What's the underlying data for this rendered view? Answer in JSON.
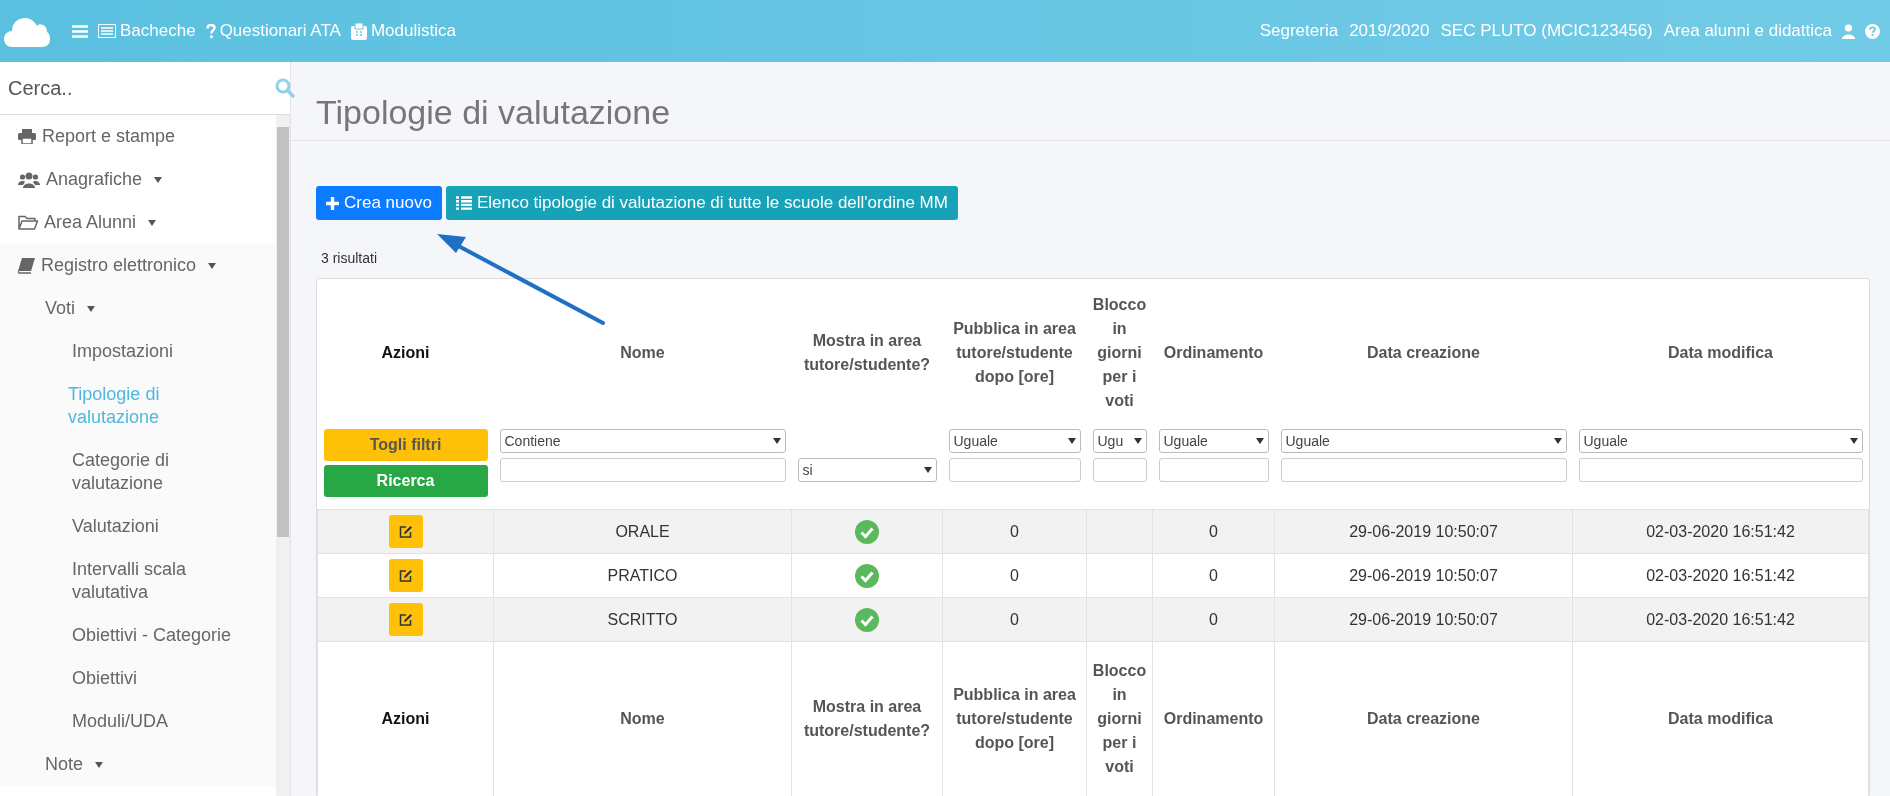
{
  "topbar": {
    "nav": [
      {
        "label": "Bacheche"
      },
      {
        "label": "Questionari ATA"
      },
      {
        "label": "Modulistica"
      }
    ],
    "info": [
      "Segreteria",
      "2019/2020",
      "SEC PLUTO (MCIC123456)",
      "Area alunni e didattica"
    ]
  },
  "sidebar": {
    "search": {
      "placeholder": "Cerca.."
    },
    "items": [
      {
        "label": "Report e stampe",
        "kind": "link"
      },
      {
        "label": "Anagrafiche",
        "kind": "group"
      },
      {
        "label": "Area Alunni",
        "kind": "group"
      },
      {
        "label": "Registro elettronico",
        "kind": "group",
        "children": [
          {
            "label": "Voti",
            "kind": "group",
            "children": [
              {
                "label": "Impostazioni",
                "selected": false
              },
              {
                "label": "Tipologie di valutazione",
                "selected": true
              },
              {
                "label": "Categorie di valutazione",
                "selected": false
              },
              {
                "label": "Valutazioni",
                "selected": false
              },
              {
                "label": "Intervalli scala valutativa",
                "selected": false
              },
              {
                "label": "Obiettivi - Categorie",
                "selected": false
              },
              {
                "label": "Obiettivi",
                "selected": false
              },
              {
                "label": "Moduli/UDA",
                "selected": false
              }
            ]
          },
          {
            "label": "Note",
            "kind": "group"
          }
        ]
      }
    ]
  },
  "page": {
    "title": "Tipologie di valutazione",
    "buttons": [
      {
        "label": "Crea nuovo",
        "kind": "primary"
      },
      {
        "label": "Elenco tipologie di valutazione di tutte le scuole dell'ordine MM",
        "kind": "info"
      }
    ],
    "result_count": "3 risultati"
  },
  "table": {
    "columns": [
      "Azioni",
      "Nome",
      "Mostra in area tutore/studente?",
      "Pubblica in area tutore/studente dopo [ore]",
      "Blocco in giorni per i voti",
      "Ordinamento",
      "Data creazione",
      "Data modifica"
    ],
    "filters": [
      {
        "kind": "buttons",
        "buttons": [
          "Togli filtri",
          "Ricerca"
        ]
      },
      {
        "kind": "select_input",
        "select": "Contiene"
      },
      {
        "kind": "select",
        "select": "si"
      },
      {
        "kind": "select_input",
        "select": "Uguale"
      },
      {
        "kind": "select_input",
        "select": "Ugu"
      },
      {
        "kind": "select_input",
        "select": "Uguale"
      },
      {
        "kind": "select_input",
        "select": "Uguale"
      },
      {
        "kind": "select_input",
        "select": "Uguale"
      }
    ],
    "rows": [
      {
        "name": "ORALE",
        "shown": true,
        "publish_after": "0",
        "order": "0",
        "created": "29-06-2019 10:50:07",
        "modified": "02-03-2020 16:51:42"
      },
      {
        "name": "PRATICO",
        "shown": true,
        "publish_after": "0",
        "order": "0",
        "created": "29-06-2019 10:50:07",
        "modified": "02-03-2020 16:51:42"
      },
      {
        "name": "SCRITTO",
        "shown": true,
        "publish_after": "0",
        "order": "0",
        "created": "29-06-2019 10:50:07",
        "modified": "02-03-2020 16:51:42"
      }
    ],
    "footer_columns": [
      "Azioni",
      "Nome",
      "Mostra in area tutore/studente?",
      "Pubblica in area tutore/studente dopo [ore]",
      "Blocco in giorni per i voti",
      "Ordinamento",
      "Data creazione",
      "Data modifica"
    ]
  }
}
